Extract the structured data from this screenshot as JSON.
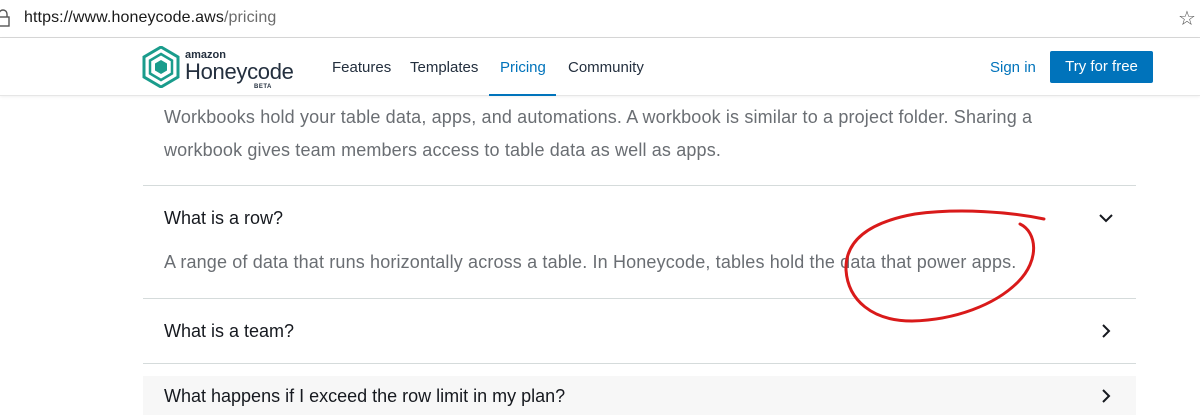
{
  "browser": {
    "url_host": "https://www.honeycode.aws",
    "url_path": "/pricing",
    "favorite_icon": "star-icon",
    "lock_icon": "lock-icon"
  },
  "header": {
    "logo": {
      "brand": "amazon",
      "name": "Honeycode",
      "badge": "BETA"
    },
    "nav": [
      "Features",
      "Templates",
      "Pricing",
      "Community"
    ],
    "active_nav": "Pricing",
    "sign_in": "Sign in",
    "cta": "Try for free"
  },
  "faq": {
    "prev_answer_line1": "Workbooks hold your table data, apps, and automations. A workbook is similar to a project folder. Sharing a",
    "prev_answer_line2": "workbook gives team members access to table data as well as apps.",
    "items": [
      {
        "question": "What is a row?",
        "answer": "A range of data that runs horizontally across a table. In Honeycode, tables hold the data that power apps.",
        "expanded": true
      },
      {
        "question": "What is a team?",
        "expanded": false
      },
      {
        "question": "What happens if I exceed the row limit in my plan?",
        "expanded": false
      }
    ]
  },
  "colors": {
    "accent": "#0073bb",
    "annotation": "#d91a1a",
    "text_primary": "#16191f",
    "text_secondary": "#6a6e73"
  }
}
